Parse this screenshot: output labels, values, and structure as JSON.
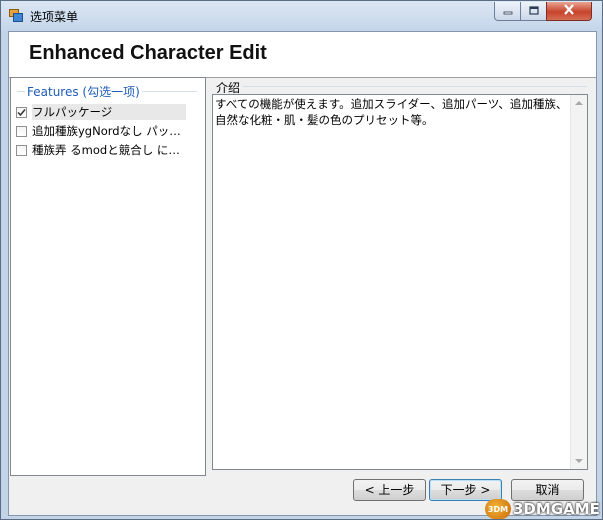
{
  "window": {
    "title": "选项菜单",
    "icon": "app-icon",
    "controls": {
      "minimize_icon": "minimize-icon",
      "maximize_icon": "maximize-icon",
      "close_icon": "close-icon"
    }
  },
  "header": {
    "title": "Enhanced Character Edit"
  },
  "features": {
    "group_label": "Features (勾选一项)",
    "items": [
      {
        "label": "フルパッケージ",
        "checked": true,
        "selected": true
      },
      {
        "label": "追加種族ygNordなし パッ…",
        "checked": false,
        "selected": false
      },
      {
        "label": "種族弄 るmodと競合し に…",
        "checked": false,
        "selected": false
      }
    ]
  },
  "description": {
    "group_label": "介绍",
    "text": "すべての機能が使えます。追加スライダー、追加パーツ、追加種族、自然な化粧・肌・髪の色のプリセット等。"
  },
  "buttons": {
    "back": "< 上一步",
    "next": "下一步 >",
    "cancel": "取消"
  },
  "watermark": {
    "logo_text": "3DM",
    "text": "3DMGAME"
  },
  "colors": {
    "group_label": "#1e5bb8",
    "close_button": "#c7432b",
    "title_bar": "#c5d6ea"
  }
}
